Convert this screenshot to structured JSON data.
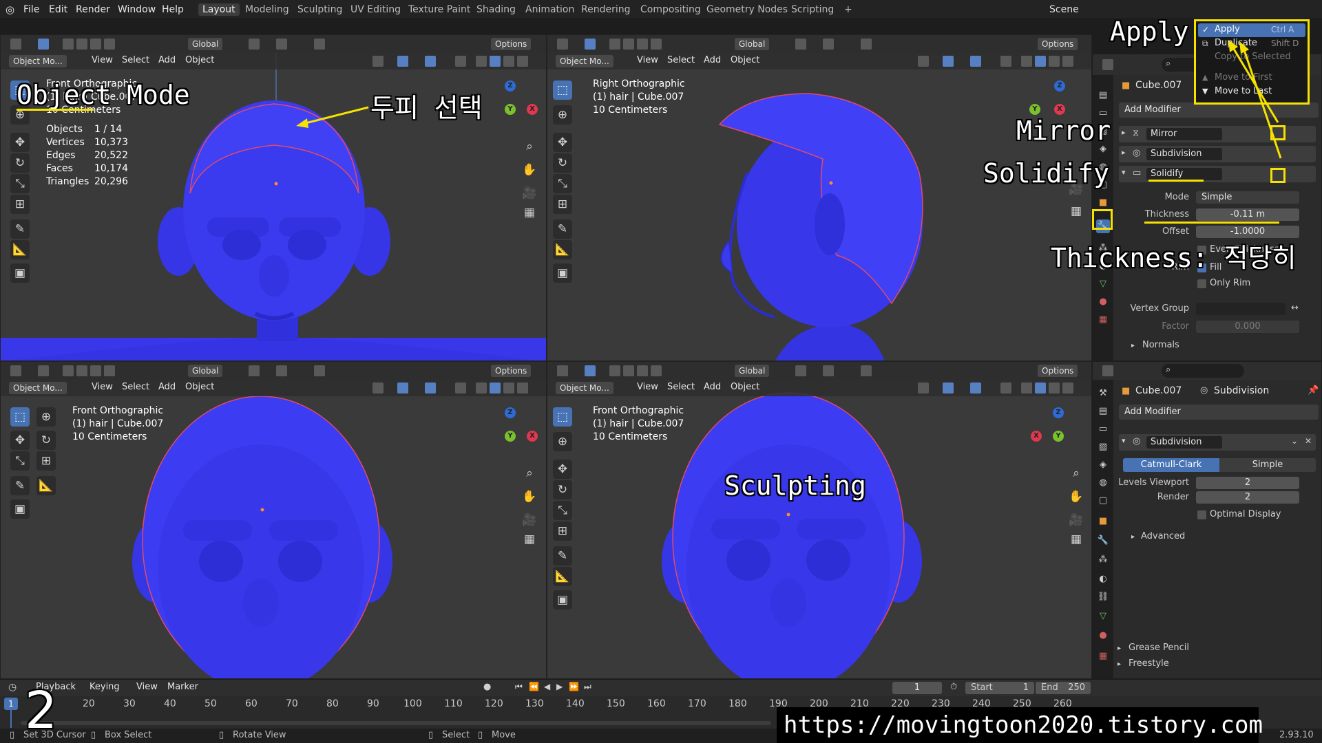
{
  "app": {
    "menus": [
      "File",
      "Edit",
      "Render",
      "Window",
      "Help"
    ],
    "workspaces": [
      "Layout",
      "Modeling",
      "Sculpting",
      "UV Editing",
      "Texture Paint",
      "Shading",
      "Animation",
      "Rendering",
      "Compositing",
      "Geometry Nodes",
      "Scripting"
    ],
    "active_workspace": "Layout",
    "add_workspace": "+",
    "scene_label": "Scene"
  },
  "viewport_header": {
    "transform": "Global",
    "options": "Options",
    "mode": "Object Mo...",
    "menu": [
      "View",
      "Select",
      "Add",
      "Object"
    ]
  },
  "viewports": [
    {
      "id": "tl",
      "view": "Front Orthographic",
      "object": "(1) hair | Cube.007",
      "scale": "10 Centimeters"
    },
    {
      "id": "tr",
      "view": "Right Orthographic",
      "object": "(1) hair | Cube.007",
      "scale": "10 Centimeters"
    },
    {
      "id": "bl",
      "view": "Front Orthographic",
      "object": "(1) hair | Cube.007",
      "scale": "10 Centimeters"
    },
    {
      "id": "br",
      "view": "Front Orthographic",
      "object": "(1) hair | Cube.007",
      "scale": "10 Centimeters"
    }
  ],
  "stats": {
    "rows": [
      {
        "label": "Objects",
        "value": "1 / 14"
      },
      {
        "label": "Vertices",
        "value": "10,373"
      },
      {
        "label": "Edges",
        "value": "20,522"
      },
      {
        "label": "Faces",
        "value": "10,174"
      },
      {
        "label": "Triangles",
        "value": "20,296"
      }
    ]
  },
  "gizmo": {
    "x": "X",
    "y": "Y",
    "z": "Z"
  },
  "properties_top": {
    "object_name": "Cube.007",
    "add_modifier": "Add Modifier",
    "modifiers": [
      "Mirror",
      "Subdivision",
      "Solidify"
    ],
    "solidify": {
      "mode_label": "Mode",
      "mode_value": "Simple",
      "thickness_label": "Thickness",
      "thickness_value": "-0.11 m",
      "offset_label": "Offset",
      "offset_value": "-1.0000",
      "even_label": "Even Thickness",
      "rim_label": "Rim",
      "fill_label": "Fill",
      "only_rim_label": "Only Rim",
      "vgroup_label": "Vertex Group",
      "factor_label": "Factor",
      "factor_value": "0.000",
      "normals_label": "Normals"
    }
  },
  "context_menu": {
    "items": [
      {
        "label": "Apply",
        "shortcut": "Ctrl A"
      },
      {
        "label": "Duplicate",
        "shortcut": "Shift D"
      },
      {
        "label": "Copy to Selected",
        "shortcut": ""
      },
      {
        "label": "Move to First",
        "shortcut": ""
      },
      {
        "label": "Move to Last",
        "shortcut": ""
      }
    ]
  },
  "properties_bottom": {
    "object_name": "Cube.007",
    "modifier_tab": "Subdivision",
    "add_modifier": "Add Modifier",
    "modifier_name": "Subdivision",
    "type_options": [
      "Catmull-Clark",
      "Simple"
    ],
    "levels_label": "Levels Viewport",
    "levels_value": "2",
    "render_label": "Render",
    "render_value": "2",
    "optimal_label": "Optimal Display",
    "advanced_label": "Advanced",
    "grease_pencil": "Grease Pencil",
    "freestyle": "Freestyle"
  },
  "annotations": {
    "object_mode": "Object Mode",
    "scalp_select": "두피 선택",
    "apply": "Apply",
    "mirror": "Mirror",
    "solidify": "Solidify",
    "thickness": "Thickness: 적당히",
    "sculpting": "Sculpting",
    "step_number": "2",
    "url": "https://movingtoon2020.tistory.com"
  },
  "timeline": {
    "menus": [
      "Playback",
      "Keying",
      "View",
      "Marker"
    ],
    "current_frame": "1",
    "start_label": "Start",
    "start_value": "1",
    "end_label": "End",
    "end_value": "250",
    "ticks": [
      "20",
      "30",
      "40",
      "50",
      "60",
      "70",
      "80",
      "90",
      "100",
      "110",
      "120",
      "130",
      "140",
      "150",
      "160",
      "170",
      "180",
      "190",
      "200",
      "210",
      "220",
      "230",
      "240",
      "250",
      "260"
    ],
    "playhead": "1"
  },
  "status": {
    "items": [
      "Set 3D Cursor",
      "Box Select",
      "Rotate View",
      "Select",
      "Move"
    ],
    "version": "2.93.10"
  },
  "colors": {
    "accent": "#4772b3",
    "mesh": "#3a3aef",
    "annotation": "#f5e200"
  }
}
